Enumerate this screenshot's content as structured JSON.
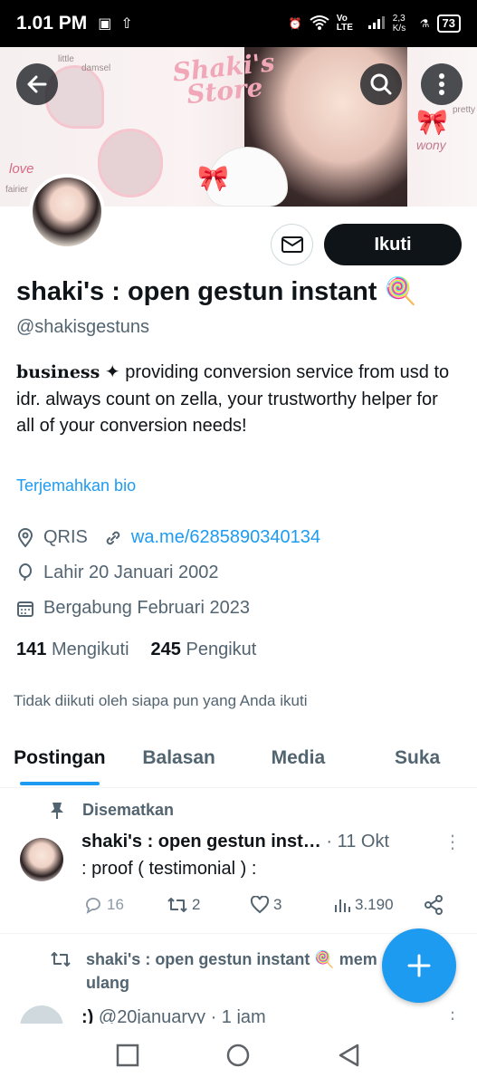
{
  "status": {
    "time": "1.01 PM",
    "network_speed": "2,3 K/s",
    "battery": "73",
    "network_label": "Vo LTE"
  },
  "banner": {
    "store_title": "Shaki's Store",
    "tiny_texts": [
      "little",
      "damsel",
      "fairier",
      "pretty"
    ],
    "love": "love",
    "wony": "wony"
  },
  "profile": {
    "name": "shaki's : open gestun instant 🍭",
    "handle": "@shakisgestuns",
    "bio_bold": "business",
    "bio_star": "✦",
    "bio_text": " providing conversion service from usd to idr. always count on zella, your trustworthy helper for all of your conversion needs!",
    "translate_label": "Terjemahkan bio",
    "location": "QRIS",
    "link": "wa.me/6285890340134",
    "birthday": "Lahir 20 Januari 2002",
    "joined": "Bergabung Februari 2023",
    "following_count": "141",
    "following_label": "Mengikuti",
    "followers_count": "245",
    "followers_label": "Pengikut",
    "not_followed": "Tidak diikuti oleh siapa pun yang Anda ikuti",
    "follow_button": "Ikuti"
  },
  "tabs": [
    "Postingan",
    "Balasan",
    "Media",
    "Suka"
  ],
  "pinned_label": "Disematkan",
  "tweet1": {
    "name": "shaki's : open gestun inst…",
    "date": " · 11 Okt",
    "text": ": proof ( testimonial ) :",
    "replies": "16",
    "retweets": "2",
    "likes": "3",
    "views": "3.190"
  },
  "retweet_label": "shaki's : open gestun instant 🍭 mem ulang",
  "tweet2": {
    "name": ":)",
    "meta": " @20januaryy · 1 jam"
  },
  "colors": {
    "accent": "#1d9bf0",
    "text": "#0f1419",
    "secondary": "#536471"
  }
}
